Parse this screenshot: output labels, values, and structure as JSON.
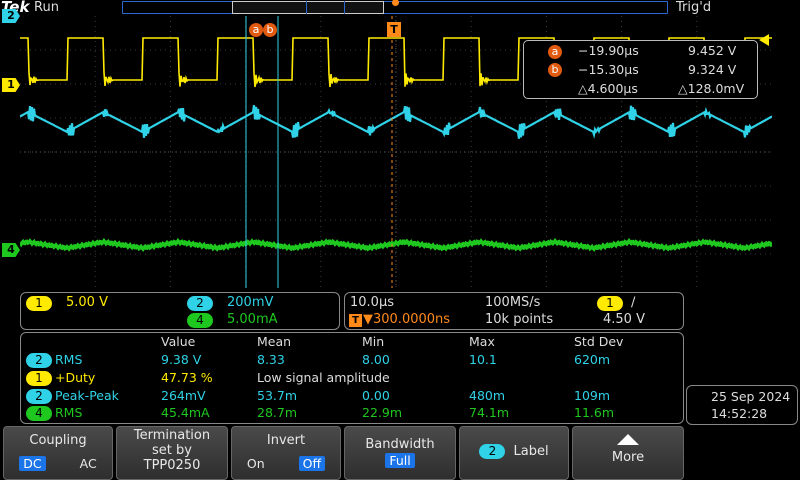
{
  "header": {
    "logo": "Tek",
    "run_state": "Run",
    "trigger_state": "Trig'd"
  },
  "markers": {
    "ch2": "2",
    "ch1": "1",
    "ch4": "4",
    "trig": "T",
    "cursor_a": "a",
    "cursor_b": "b"
  },
  "cursors": {
    "a": {
      "label": "a",
      "time": "−19.90µs",
      "value": "9.452 V"
    },
    "b": {
      "label": "b",
      "time": "−15.30µs",
      "value": "9.324 V"
    },
    "delta_time": "△4.600µs",
    "delta_value": "△128.0mV"
  },
  "channels": {
    "ch1": {
      "id": "1",
      "scale": "5.00 V",
      "color": "#ffea00"
    },
    "ch2": {
      "id": "2",
      "scale": "200mV",
      "color": "#2fd2e6"
    },
    "ch4": {
      "id": "4",
      "scale": "5.00mA",
      "color": "#1fc81f"
    }
  },
  "timebase": {
    "scale": "10.0µs",
    "sample_rate": "100MS/s",
    "trig_pos": "▼300.0000ns",
    "record": "10k points",
    "trig_ch": "1",
    "trig_slope": "∕",
    "trig_level": "4.50 V"
  },
  "measurements": {
    "headers": [
      "Value",
      "Mean",
      "Min",
      "Max",
      "Std Dev"
    ],
    "rows": [
      {
        "ch": "2",
        "name": "RMS",
        "value": "9.38 V",
        "mean": "8.33",
        "min": "8.00",
        "max": "10.1",
        "std": "620m",
        "color": "c"
      },
      {
        "ch": "1",
        "name": "+Duty",
        "value": "47.73 %",
        "note": "Low signal amplitude",
        "color": "y"
      },
      {
        "ch": "2",
        "name": "Peak-Peak",
        "value": "264mV",
        "mean": "53.7m",
        "min": "0.00",
        "max": "480m",
        "std": "109m",
        "color": "c"
      },
      {
        "ch": "4",
        "name": "RMS",
        "value": "45.4mA",
        "mean": "28.7m",
        "min": "22.9m",
        "max": "74.1m",
        "std": "11.6m",
        "color": "g"
      }
    ]
  },
  "datetime": {
    "date": "25 Sep  2024",
    "time": "14:52:28"
  },
  "buttons": {
    "coupling": {
      "title": "Coupling",
      "opt1": "DC",
      "opt2": "AC"
    },
    "termination": {
      "line1": "Termination",
      "line2": "set by",
      "line3": "TPP0250"
    },
    "invert": {
      "title": "Invert",
      "opt1": "On",
      "opt2": "Off"
    },
    "bandwidth": {
      "title": "Bandwidth",
      "value": "Full"
    },
    "label": {
      "ch": "2",
      "title": "Label"
    },
    "more": {
      "title": "More"
    }
  }
}
